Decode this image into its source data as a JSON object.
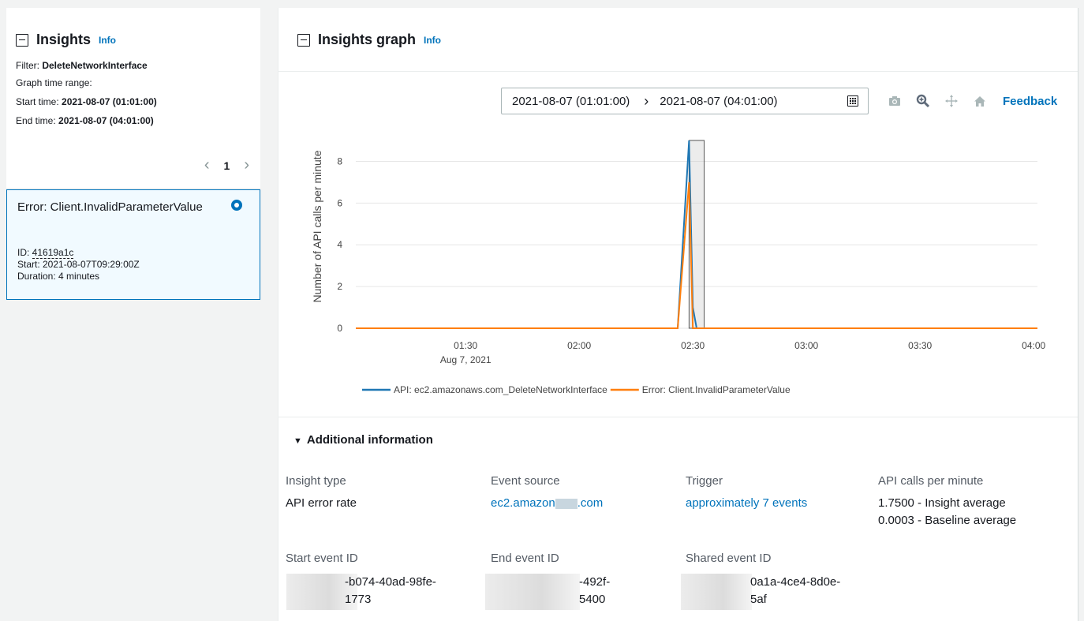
{
  "left": {
    "title": "Insights",
    "info": "Info",
    "filter_label": "Filter:",
    "filter_value": "DeleteNetworkInterface",
    "range_label": "Graph time range:",
    "start_label": "Start time:",
    "start_value": "2021-08-07 (01:01:00)",
    "end_label": "End time:",
    "end_value": "2021-08-07 (04:01:00)",
    "page": "1",
    "card": {
      "title": "Error: Client.InvalidParameterValue",
      "id_label": "ID: ",
      "id_value": "41619a1c",
      "start": "Start: 2021-08-07T09:29:00Z",
      "duration": "Duration: 4 minutes"
    }
  },
  "right": {
    "title": "Insights graph",
    "info": "Info",
    "range_start": "2021-08-07 (01:01:00)",
    "range_end": "2021-08-07 (04:01:00)",
    "feedback": "Feedback"
  },
  "chart_data": {
    "type": "line",
    "ylabel": "Number of API calls per minute",
    "xlabel": "",
    "x_ticks": [
      "01:30",
      "02:00",
      "02:30",
      "03:00",
      "03:30",
      "04:00"
    ],
    "x_sublabel": "Aug 7, 2021",
    "y_ticks": [
      0,
      2,
      4,
      6,
      8
    ],
    "ylim": [
      0,
      9
    ],
    "xlim": [
      "01:01",
      "04:01"
    ],
    "highlight_range": [
      "02:29",
      "02:33"
    ],
    "series": [
      {
        "name": "API: ec2.amazonaws.com_DeleteNetworkInterface",
        "color": "#1f77b4",
        "points": [
          [
            "01:01",
            0
          ],
          [
            "02:26",
            0
          ],
          [
            "02:29",
            9
          ],
          [
            "02:30",
            1
          ],
          [
            "02:31",
            0
          ],
          [
            "04:01",
            0
          ]
        ]
      },
      {
        "name": "Error: Client.InvalidParameterValue",
        "color": "#ff7f0e",
        "points": [
          [
            "01:01",
            0
          ],
          [
            "02:26",
            0
          ],
          [
            "02:29",
            7
          ],
          [
            "02:30",
            0
          ],
          [
            "04:01",
            0
          ]
        ]
      }
    ]
  },
  "additional": {
    "title": "Additional information",
    "insight_type_label": "Insight type",
    "insight_type_value": "API error rate",
    "event_source_label": "Event source",
    "event_source_pre": "ec2.amazon",
    "event_source_post": ".com",
    "trigger_label": "Trigger",
    "trigger_value": "approximately 7 events",
    "api_calls_label": "API calls per minute",
    "api_calls_insight": "1.7500 - Insight average",
    "api_calls_baseline": "0.0003 - Baseline average",
    "start_event_label": "Start event ID",
    "start_event_l1": "-b074-40ad-98fe-",
    "start_event_l2": "1773",
    "end_event_label": "End event ID",
    "end_event_l1": "-492f-",
    "end_event_l2": "5400",
    "shared_event_label": "Shared event ID",
    "shared_event_l1": "0a1a-4ce4-8d0e-",
    "shared_event_l2": "5af"
  }
}
